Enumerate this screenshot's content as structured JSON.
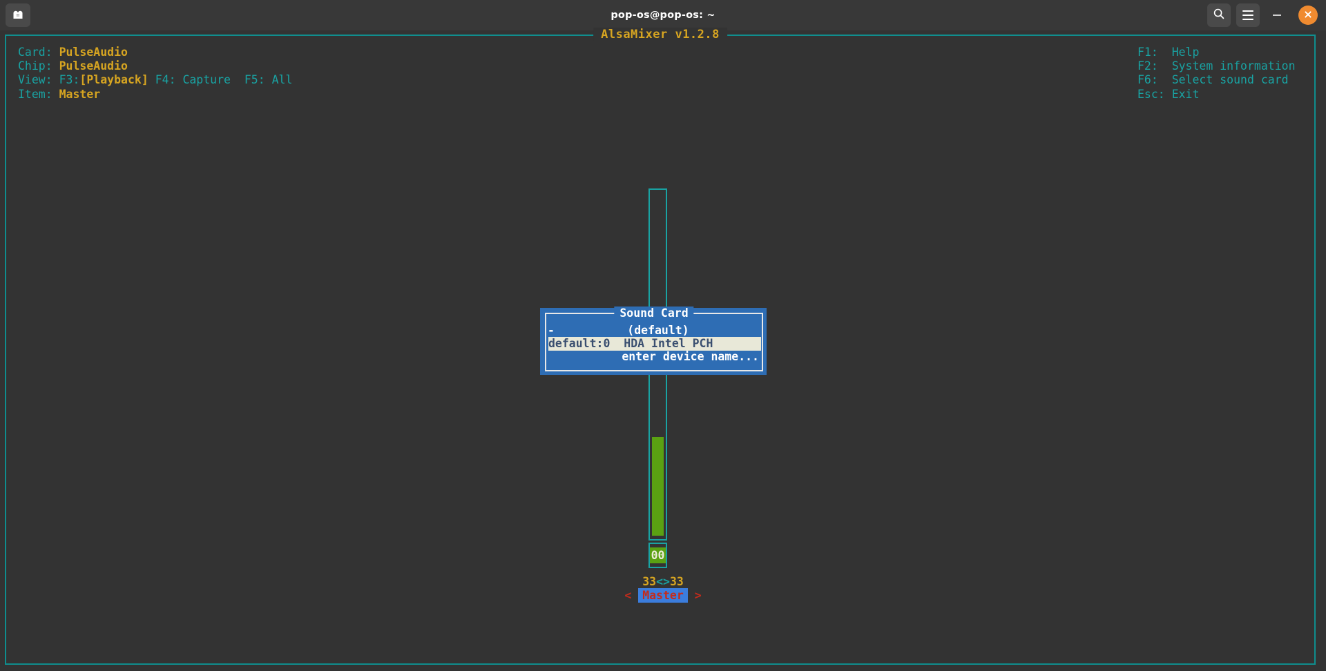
{
  "window": {
    "title": "pop-os@pop-os: ~",
    "left_icon": "terminal-add-icon",
    "controls": {
      "search": "search-icon",
      "menu": "hamburger-menu-icon",
      "minimize": "minimize-icon",
      "close": "close-icon"
    },
    "accent_close_color": "#f08b30",
    "titlebar_bg": "#383838"
  },
  "app": {
    "frame_title": "AlsaMixer v1.2.8",
    "frame_border_color": "#0f8e8e",
    "title_color": "#d7a521",
    "terminal_bg": "#333333"
  },
  "header": {
    "left": [
      {
        "label": "Card:",
        "value": "PulseAudio"
      },
      {
        "label": "Chip:",
        "value": "PulseAudio"
      }
    ],
    "view": {
      "label": "View:",
      "f3_key": "F3:",
      "f3_value": "[Playback]",
      "f4": "F4: Capture",
      "f5": "F5: All"
    },
    "item": {
      "label": "Item:",
      "value": "Master"
    },
    "right": [
      {
        "key": "F1:",
        "desc": "Help"
      },
      {
        "key": "F2:",
        "desc": "System information"
      },
      {
        "key": "F6:",
        "desc": "Select sound card"
      },
      {
        "key": "Esc:",
        "desc": "Exit"
      }
    ]
  },
  "mixer": {
    "volume_value": "00",
    "fill_color": "#5aa112",
    "outline_color": "#19a3a3",
    "balance": {
      "left": "33",
      "separator": "<>",
      "right": "33"
    },
    "item_label": "Master",
    "left_arrow": "<",
    "right_arrow": ">",
    "item_highlight_bg": "#3b7ddd",
    "item_text_color": "#c42b1c"
  },
  "dialog": {
    "title": "Sound Card",
    "bg": "#2e6db4",
    "border": "#e8e8e8",
    "rows": [
      {
        "id": "-",
        "name": "(default)",
        "selected": false
      },
      {
        "id": "default:0",
        "name": "HDA Intel PCH",
        "selected": true
      },
      {
        "id": "",
        "name": "enter device name...",
        "selected": false
      }
    ]
  }
}
